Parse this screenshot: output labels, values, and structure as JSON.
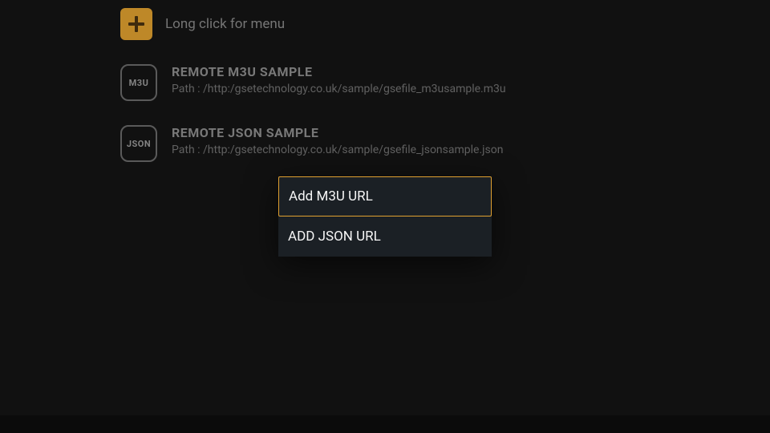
{
  "header": {
    "hint": "Long click for menu"
  },
  "playlists": [
    {
      "badge": "M3U",
      "title": "REMOTE M3U SAMPLE",
      "path": "Path : /http:/gsetechnology.co.uk/sample/gsefile_m3usample.m3u"
    },
    {
      "badge": "JSON",
      "title": "REMOTE JSON SAMPLE",
      "path": "Path : /http:/gsetechnology.co.uk/sample/gsefile_jsonsample.json"
    }
  ],
  "menu": {
    "items": [
      {
        "label": "Add M3U URL",
        "selected": true
      },
      {
        "label": "ADD JSON URL",
        "selected": false
      }
    ]
  },
  "colors": {
    "accent": "#E0A030",
    "background": "#141414",
    "menu_bg": "#1b2025"
  }
}
